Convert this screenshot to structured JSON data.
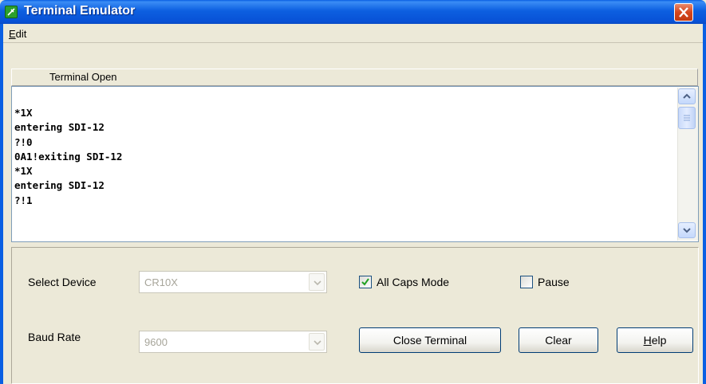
{
  "window": {
    "title": "Terminal Emulator",
    "accent_color": "#0a5fe3",
    "close_color": "#d5451d",
    "icon": "app-icon"
  },
  "menu": {
    "edit_prefix": "E",
    "edit_rest": "dit"
  },
  "status": {
    "text": "Terminal Open"
  },
  "terminal": {
    "lines": [
      "*1X",
      "entering SDI-12",
      "?!0",
      "0A1!exiting SDI-12",
      "*1X",
      "entering SDI-12",
      "?!1"
    ]
  },
  "controls": {
    "select_device_label": "Select Device",
    "select_device_value": "CR10X",
    "baud_rate_label": "Baud Rate",
    "baud_rate_value": "9600",
    "all_caps_label": "All Caps Mode",
    "all_caps_checked": true,
    "pause_label": "Pause",
    "pause_checked": false
  },
  "buttons": {
    "close_terminal": "Close Terminal",
    "clear": "Clear",
    "help_prefix": "H",
    "help_rest": "elp"
  }
}
